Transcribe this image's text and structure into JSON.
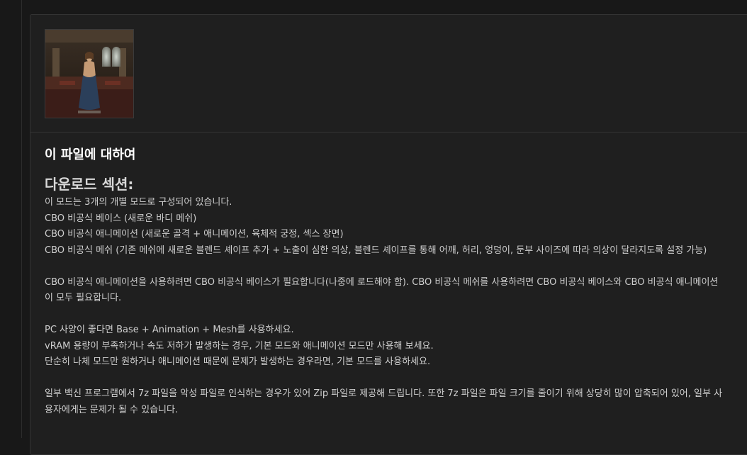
{
  "about": {
    "title": "이 파일에 대하여",
    "section_heading": "다운로드 섹션:",
    "lines": [
      "이 모드는 3개의 개별 모드로 구성되어 있습니다.",
      "CBO 비공식 베이스 (새로운 바디 메쉬)",
      "CBO 비공식 애니메이션 (새로운 골격 + 애니메이션, 육체적 궁정, 섹스 장면)",
      "CBO 비공식 메쉬 (기존 메쉬에 새로운 블렌드 셰이프 추가 + 노출이 심한 의상, 블렌드 셰이프를 통해 어깨, 허리, 엉덩이, 둔부 사이즈에 따라 의상이 달라지도록 설정 가능)"
    ],
    "paragraph_requirements": "CBO 비공식 애니메이션을 사용하려면 CBO 비공식 베이스가 필요합니다(나중에 로드해야 함). CBO 비공식 메쉬를 사용하려면 CBO 비공식 베이스와 CBO 비공식 애니메이션이 모두 필요합니다.",
    "recommendations": [
      "PC 사양이 좋다면 Base + Animation + Mesh를 사용하세요.",
      "vRAM 용량이 부족하거나 속도 저하가 발생하는 경우, 기본 모드와 애니메이션 모드만 사용해 보세요.",
      "단순히 나체 모드만 원하거나 애니메이션 때문에 문제가 발생하는 경우라면, 기본 모드를 사용하세요."
    ],
    "paragraph_antivirus": "일부 백신 프로그램에서 7z 파일을 악성 파일로 인식하는 경우가 있어 Zip 파일로 제공해 드립니다. 또한 7z 파일은 파일 크기를 줄이기 위해 상당히 많이 압축되어 있어, 일부 사용자에게는 문제가 될 수 있습니다."
  },
  "colors": {
    "page_bg": "#181818",
    "panel_bg": "#1f1f1f",
    "border": "#333333",
    "title": "#ffffff",
    "heading": "#d8d8d8",
    "text": "#cfcfcf"
  },
  "icons": {
    "thumbnail": "mod-preview-image"
  }
}
